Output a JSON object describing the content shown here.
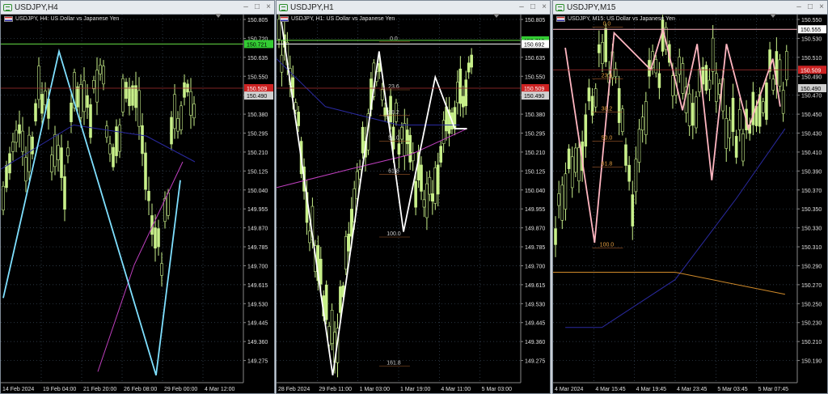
{
  "windows": [
    {
      "id": "h4",
      "title": "USDJPY,H4",
      "symbol_label": "USDJPY, H4:  US Dollar vs Japanese Yen",
      "yticks": [
        "150.805",
        "150.720",
        "150.635",
        "150.550",
        "150.465",
        "150.380",
        "150.295",
        "150.210",
        "150.125",
        "150.040",
        "149.955",
        "149.870",
        "149.785",
        "149.700",
        "149.615",
        "149.530",
        "149.445",
        "149.360",
        "149.275"
      ],
      "xticks": [
        "14 Feb 2024",
        "19 Feb 04:00",
        "21 Feb 20:00",
        "26 Feb 08:00",
        "29 Feb 00:00",
        "4 Mar 12:00"
      ],
      "price_tags": [
        {
          "text": "150.721",
          "bg": "#33cc33",
          "fg": "#000"
        },
        {
          "text": "150.509",
          "bg": "#cc2222",
          "fg": "#fff"
        },
        {
          "text": "150.490",
          "bg": "#d0d0d0",
          "fg": "#000"
        }
      ],
      "fib_labels": []
    },
    {
      "id": "h1",
      "title": "USDJPY,H1",
      "symbol_label": "USDJPY, H1:  US Dollar vs Japanese Yen",
      "yticks": [
        "150.805",
        "150.720",
        "150.635",
        "150.550",
        "150.465",
        "150.380",
        "150.295",
        "150.210",
        "150.125",
        "150.040",
        "149.955",
        "149.870",
        "149.785",
        "149.700",
        "149.615",
        "149.530",
        "149.445",
        "149.360",
        "149.275"
      ],
      "xticks": [
        "28 Feb 2024",
        "29 Feb 11:00",
        "1 Mar 03:00",
        "1 Mar 19:00",
        "4 Mar 11:00",
        "5 Mar 03:00"
      ],
      "price_tags": [
        {
          "text": "150.710",
          "bg": "#33cc33",
          "fg": "#000"
        },
        {
          "text": "150.692",
          "bg": "#ffffff",
          "fg": "#000"
        },
        {
          "text": "150.509",
          "bg": "#cc2222",
          "fg": "#fff"
        },
        {
          "text": "150.490",
          "bg": "#d0d0d0",
          "fg": "#000"
        }
      ],
      "fib_labels": [
        "0.0",
        "23.6",
        "38.2",
        "50.0",
        "61.8",
        "100.0",
        "161.8"
      ]
    },
    {
      "id": "m15",
      "title": "USDJPY,M15",
      "symbol_label": "USDJPY, M15:  US Dollar vs Japanese Yen",
      "yticks": [
        "150.550",
        "150.530",
        "150.510",
        "150.490",
        "150.470",
        "150.450",
        "150.430",
        "150.410",
        "150.390",
        "150.370",
        "150.350",
        "150.330",
        "150.310",
        "150.290",
        "150.270",
        "150.250",
        "150.230",
        "150.210",
        "150.190"
      ],
      "xticks": [
        "4 Mar 2024",
        "4 Mar 15:45",
        "4 Mar 19:45",
        "4 Mar 23:45",
        "5 Mar 03:45",
        "5 Mar 07:45"
      ],
      "price_tags": [
        {
          "text": "150.555",
          "bg": "#ffffff",
          "fg": "#000"
        },
        {
          "text": "150.509",
          "bg": "#cc2222",
          "fg": "#fff"
        },
        {
          "text": "150.490",
          "bg": "#d0d0d0",
          "fg": "#000"
        }
      ],
      "fib_labels": [
        "0.0",
        "23.6",
        "38.2",
        "50.0",
        "61.8",
        "100.0"
      ]
    }
  ],
  "colors": {
    "candle": "#c8f08a",
    "zigzag_h4": "#7fe0ff",
    "zigzag_h1": "#ffffff",
    "zigzag_m15": "#ffb6c1",
    "ma_fast": "#8fbf5f",
    "ma_slow": "#c040c0",
    "ma_long": "#d08a2a",
    "grid": "#3b4a5a",
    "axis_text": "#e0e0e0"
  },
  "icons": [
    "chart-window-icon",
    "minimize-icon",
    "maximize-icon",
    "close-icon",
    "us-flag-icon"
  ]
}
